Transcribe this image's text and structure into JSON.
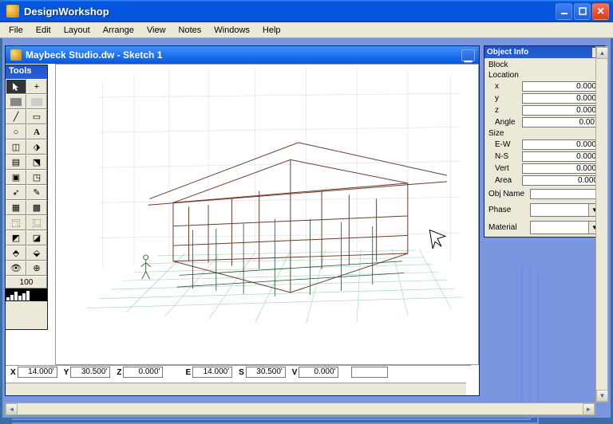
{
  "app_title": "DesignWorkshop",
  "menu": [
    "File",
    "Edit",
    "Layout",
    "Arrange",
    "View",
    "Notes",
    "Windows",
    "Help"
  ],
  "document": {
    "title": "Maybeck Studio.dw - Sketch 1"
  },
  "tools_palette": {
    "title": "Tools",
    "zoom_value": "100"
  },
  "coordinates": {
    "x_label": "X",
    "x": "14.000'",
    "y_label": "Y",
    "y": "30.500'",
    "z_label": "Z",
    "z": "0.000'",
    "e_label": "E",
    "e": "14.000'",
    "s_label": "S",
    "s": "30.500'",
    "v_label": "V",
    "v": "0.000'"
  },
  "object_info": {
    "title": "Object Info",
    "block_label": "Block",
    "location_label": "Location",
    "x_label": "x",
    "x": "0.000'",
    "y_label": "y",
    "y": "0.000'",
    "z_label": "z",
    "z": "0.000'",
    "angle_label": "Angle",
    "angle": "0.00°",
    "size_label": "Size",
    "ew_label": "E-W",
    "ew": "0.000'",
    "ns_label": "N-S",
    "ns": "0.000'",
    "vert_label": "Vert",
    "vert": "0.000'",
    "area_label": "Area",
    "area": "0.000",
    "obj_name_label": "Obj Name",
    "obj_name": "",
    "phase_label": "Phase",
    "phase": "",
    "material_label": "Material",
    "material": ""
  }
}
